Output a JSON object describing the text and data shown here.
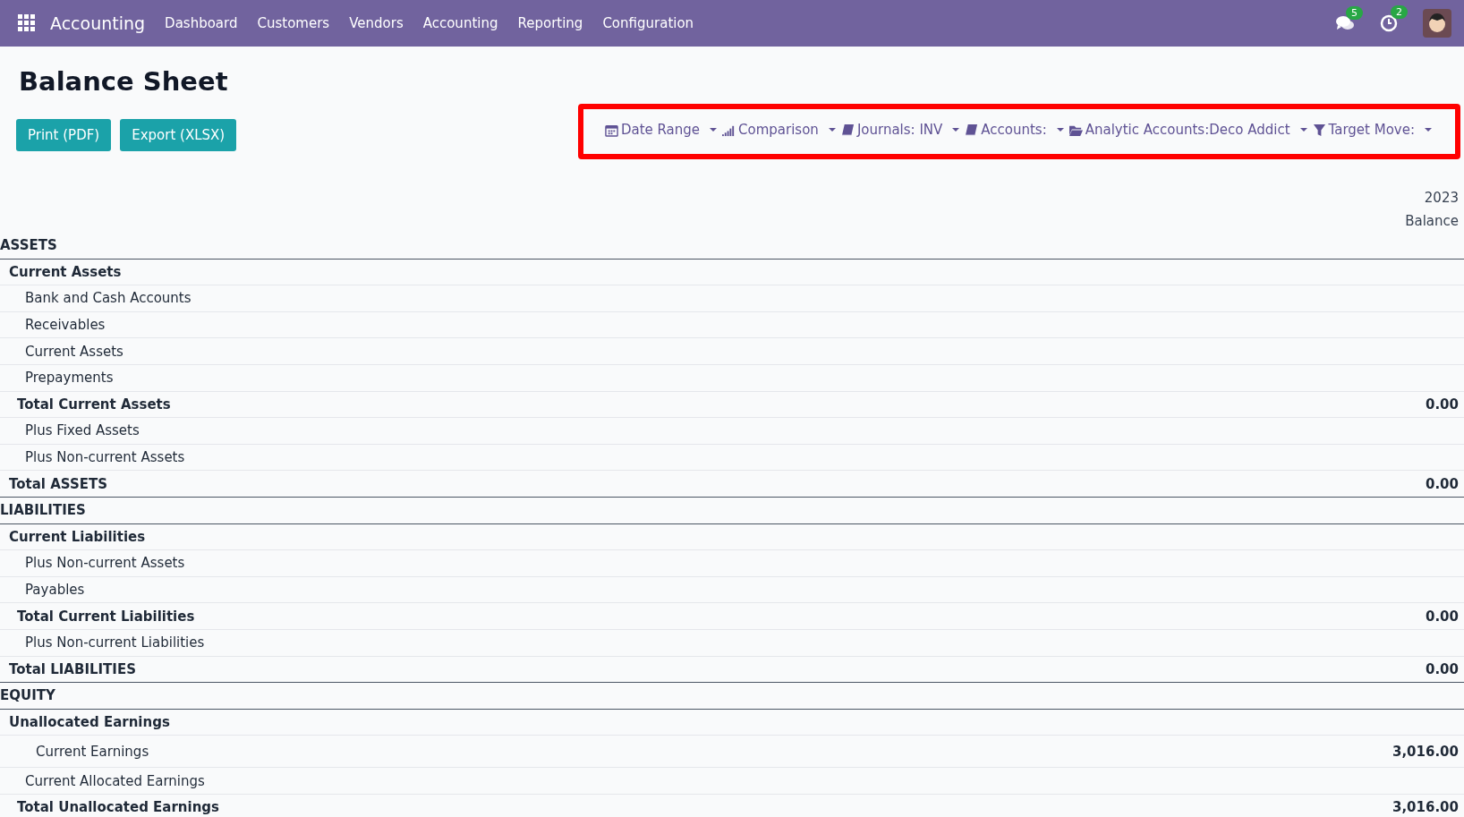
{
  "navbar": {
    "app_name": "Accounting",
    "menu": [
      "Dashboard",
      "Customers",
      "Vendors",
      "Accounting",
      "Reporting",
      "Configuration"
    ],
    "messages_count": "5",
    "activities_count": "2"
  },
  "title": "Balance Sheet",
  "buttons": [
    "Print (PDF)",
    "Export (XLSX)"
  ],
  "filters_highlighted": true,
  "filters": [
    {
      "kind": "calendar",
      "label": "Date Range"
    },
    {
      "kind": "signal",
      "label": "Comparison"
    },
    {
      "kind": "book",
      "label": "Journals: INV"
    },
    {
      "kind": "book",
      "label": "Accounts:"
    },
    {
      "kind": "folder",
      "label": "Analytic Accounts:Deco Addict"
    },
    {
      "kind": "funnel",
      "label": "Target Move:"
    }
  ],
  "column_header": [
    "2023",
    "Balance"
  ],
  "rows": [
    {
      "kind": "section",
      "label": "ASSETS",
      "children": [
        {
          "kind": "group",
          "label": "Current Assets",
          "children": [
            {
              "kind": "account",
              "label": "Bank and Cash Accounts"
            },
            {
              "kind": "account",
              "label": "Receivables"
            },
            {
              "kind": "account",
              "label": "Current Assets"
            },
            {
              "kind": "account",
              "label": "Prepayments"
            },
            {
              "kind": "total",
              "label": "Total Current Assets",
              "amount": "0.00"
            },
            {
              "kind": "account",
              "label": "Plus Fixed Assets"
            },
            {
              "kind": "account",
              "label": "Plus Non-current Assets"
            }
          ]
        },
        {
          "kind": "total",
          "label": "Total ASSETS",
          "amount": "0.00"
        }
      ]
    },
    {
      "kind": "section",
      "label": "LIABILITIES",
      "children": [
        {
          "kind": "group",
          "label": "Current Liabilities",
          "children": [
            {
              "kind": "account",
              "label": "Plus Non-current Assets"
            },
            {
              "kind": "account",
              "label": "Payables"
            },
            {
              "kind": "total",
              "label": "Total Current Liabilities",
              "amount": "0.00"
            },
            {
              "kind": "account",
              "label": "Plus Non-current Liabilities"
            }
          ]
        },
        {
          "kind": "total",
          "label": "Total LIABILITIES",
          "amount": "0.00"
        }
      ]
    },
    {
      "kind": "section",
      "label": "EQUITY",
      "children": [
        {
          "kind": "group",
          "label": "Unallocated Earnings",
          "children": [
            {
              "kind": "detail",
              "label": "Current Earnings",
              "amount": "3,016.00"
            },
            {
              "kind": "account",
              "label": "Current Allocated Earnings"
            },
            {
              "kind": "total",
              "label": "Total Unallocated Earnings",
              "amount": "3,016.00"
            }
          ]
        }
      ]
    }
  ]
}
